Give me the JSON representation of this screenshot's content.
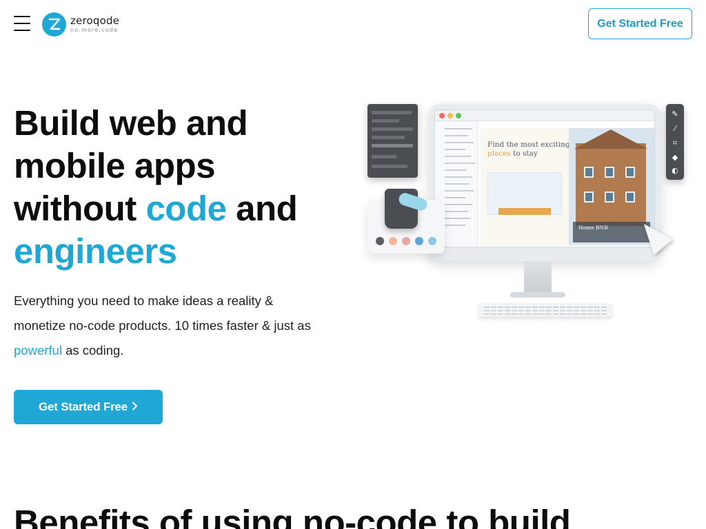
{
  "header": {
    "menu_icon": "hamburger-menu-icon",
    "logo": {
      "name": "zeroqode",
      "tagline": "no.more.code",
      "mark_icon": "zeroqode-logo-icon"
    },
    "cta_label": "Get Started Free"
  },
  "hero": {
    "title": {
      "line1": "Build web and",
      "line2": "mobile apps",
      "line3_prefix": "without ",
      "line3_accent": "code",
      "line3_suffix": " and",
      "line4_accent": "engineers"
    },
    "description": {
      "text1": "Everything you need to make ideas a reality &",
      "text2": "monetize no-code products. 10 times faster & just as",
      "link": "powerful",
      "text3": " as coding."
    },
    "cta_label": "Get Started Free",
    "cta_icon": "chevron-right-icon"
  },
  "illustration": {
    "canvas_heading_1": "Find the most exciting",
    "canvas_heading_accent": "places",
    "canvas_heading_2": " to stay",
    "card_label": "Home BNB",
    "swatch_colors": [
      "#5a5d62",
      "#f0b894",
      "#eaa7a0",
      "#5aa8d8",
      "#8ec8e8"
    ]
  },
  "section": {
    "title": "Benefits of using no-code to build"
  },
  "colors": {
    "accent": "#1fa8d6",
    "text": "#0d0d0d"
  }
}
